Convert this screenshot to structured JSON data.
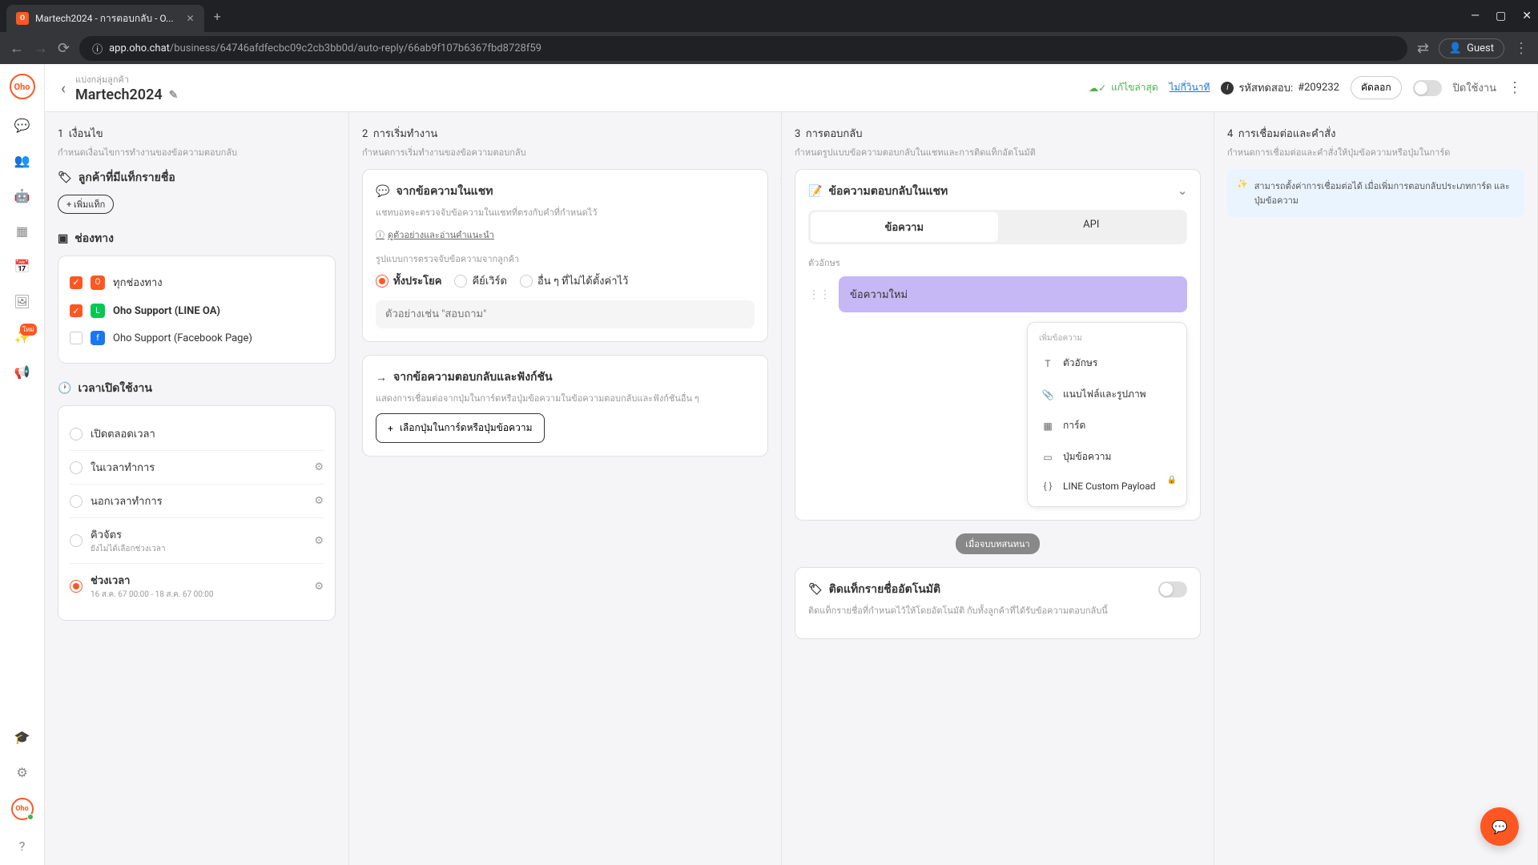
{
  "browser": {
    "tab_title": "Martech2024 - การตอบกลับ - O...",
    "url_host": "app.oho.chat",
    "url_path": "/business/64746afdfecbc09c2cb3bb0d/auto-reply/66ab9f107b6367fbd8728f59",
    "guest_label": "Guest"
  },
  "header": {
    "breadcrumb": "แบ่งกลุ่มลูกค้า",
    "title": "Martech2024",
    "save_status": "แก้ไขล่าสุด",
    "save_link": "ไม่กี่วินาที",
    "test_code_label": "รหัสทดสอบ:",
    "test_code_value": "#209232",
    "copy_label": "คัดลอก",
    "toggle_label": "ปิดใช้งาน"
  },
  "col1": {
    "step": "1",
    "title": "เงื่อนไข",
    "desc": "กำหนดเงื่อนไขการทำงานของข้อความตอบกลับ",
    "tags_section": "ลูกค้าที่มีแท็กรายชื่อ",
    "add_tag": "+ เพิ่มแท็ก",
    "channels_section": "ช่องทาง",
    "channels": [
      {
        "label": "ทุกช่องทาง",
        "checked": true
      },
      {
        "label": "Oho Support (LINE OA)",
        "checked": true,
        "icon": "line"
      },
      {
        "label": "Oho Support (Facebook Page)",
        "checked": false,
        "icon": "fb"
      }
    ],
    "schedule_section": "เวลาเปิดใช้งาน",
    "schedule": [
      {
        "label": "เปิดตลอดเวลา",
        "selected": false
      },
      {
        "label": "ในเวลาทำการ",
        "selected": false,
        "gear": true
      },
      {
        "label": "นอกเวลาทำการ",
        "selected": false,
        "gear": true
      },
      {
        "label": "คิวจัตร",
        "sub": "ยังไม่ได้เลือกช่วงเวลา",
        "selected": false,
        "gear": true
      },
      {
        "label": "ช่วงเวลา",
        "sub": "16 ส.ค. 67 00:00 - 18 ส.ค. 67 00:00",
        "selected": true,
        "gear": true
      }
    ]
  },
  "col2": {
    "step": "2",
    "title": "การเริ่มทำงาน",
    "desc": "กำหนดการเริ่มทำงานของข้อความตอบกลับ",
    "chat_card_title": "จากข้อความในแชท",
    "chat_card_desc": "แชทบอทจะตรวจจับข้อความในแชทที่ตรงกับคำที่กำหนดไว้",
    "help_link": "ดูตัวอย่างและอ่านคำแนะนำ",
    "match_label": "รูปแบบการตรวจจับข้อความจากลูกค้า",
    "match_options": [
      "ทั้งประโยค",
      "คีย์เวิร์ด",
      "อื่น ๆ ที่ไม่ได้ตั้งค่าไว้"
    ],
    "match_selected": 0,
    "example_placeholder": "ตัวอย่างเช่น \"สอบถาม\"",
    "func_card_title": "จากข้อความตอบกลับและฟังก์ชัน",
    "func_card_desc": "แสดงการเชื่อมต่อจากปุ่มในการ์ดหรือปุ่มข้อความในข้อความตอบกลับและฟังก์ชันอื่น ๆ",
    "func_btn": "เลือกปุ่มในการ์ดหรือปุ่มข้อความ"
  },
  "col3": {
    "step": "3",
    "title": "การตอบกลับ",
    "desc": "กำหนดรูปแบบข้อความตอบกลับในแชทและการติดแท็กอัตโนมัติ",
    "reply_card_title": "ข้อความตอบกลับในแชท",
    "tabs": [
      "ข้อความ",
      "API"
    ],
    "tab_selected": 0,
    "text_label": "ตัวอักษร",
    "message_text": "ข้อความใหม่",
    "add_menu_label": "เพิ่มข้อความ",
    "add_menu_items": [
      "ตัวอักษร",
      "แนบไฟล์และรูปภาพ",
      "การ์ด",
      "ปุ่มข้อความ",
      "LINE Custom Payload"
    ],
    "save_btn": "เมื่อจบบทสนทนา",
    "auto_tag_title": "ติดแท็กรายชื่ออัตโนมัติ",
    "auto_tag_desc": "ติดแท็กรายชื่อที่กำหนดไว้ให้โดยอัตโนมัติ กับทั้งลูกค้าที่ได้รับข้อความตอบกลับนี้"
  },
  "col4": {
    "step": "4",
    "title": "การเชื่อมต่อและคำสั่ง",
    "desc": "กำหนดการเชื่อมต่อและคำสั่งให้ปุ่มข้อความหรือปุ่มในการ์ด",
    "hint": "สามารถตั้งค่าการเชื่อมต่อได้ เมื่อเพิ่มการตอบกลับประเภทการ์ด และ ปุ่มข้อความ"
  }
}
